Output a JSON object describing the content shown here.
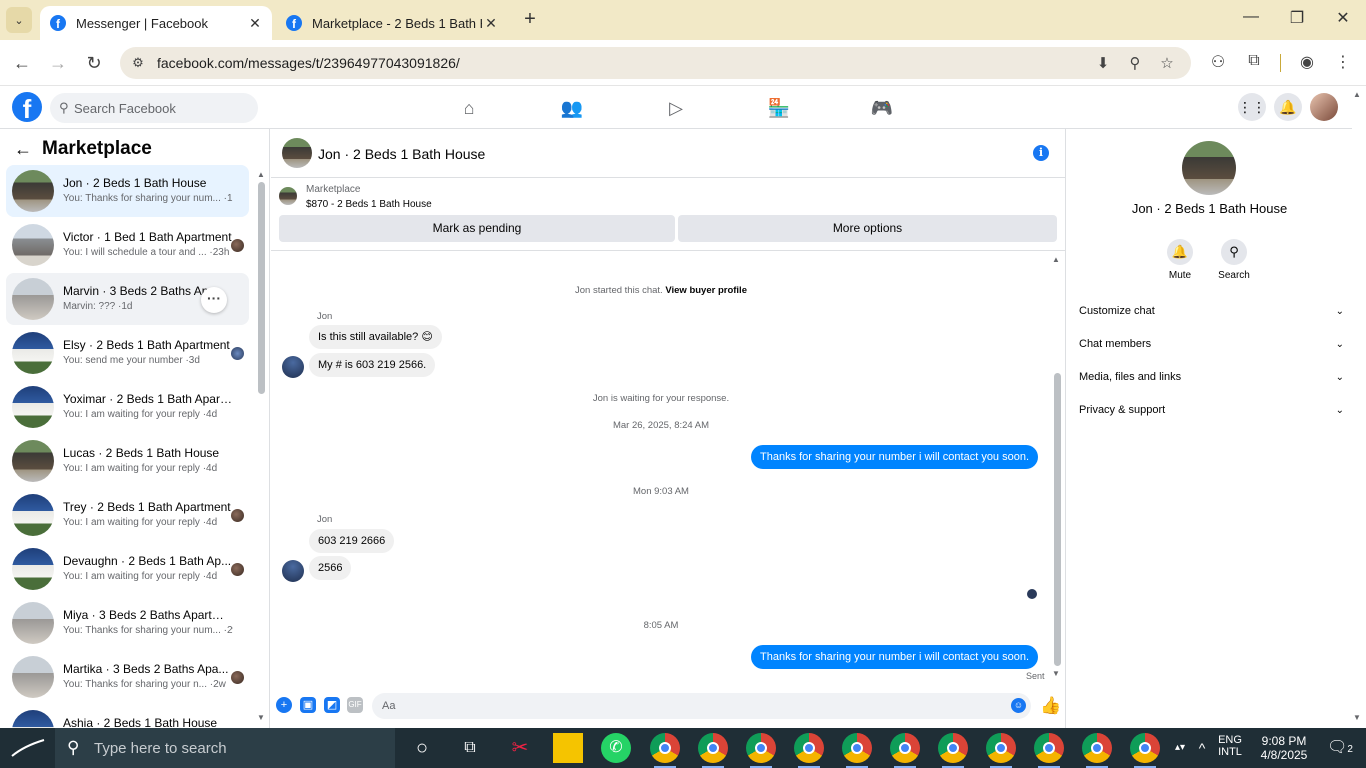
{
  "browser": {
    "tabs": [
      {
        "title": "Messenger | Facebook",
        "close": "✕"
      },
      {
        "title": "Marketplace - 2 Beds 1 Bath Ho",
        "close": "✕"
      }
    ],
    "new_tab": "+",
    "url": "facebook.com/messages/t/23964977043091826/"
  },
  "facebook": {
    "logo": "f",
    "search_placeholder": "Search Facebook"
  },
  "sidebar": {
    "title": "Marketplace",
    "conversations": [
      {
        "name": "Jon · 2 Beds 1 Bath House",
        "snippet": "You: Thanks for sharing your num... ·1m"
      },
      {
        "name": "Victor · 1 Bed 1 Bath Apartment",
        "snippet": "You: I will schedule a tour and ... ·23h"
      },
      {
        "name": "Marvin · 3 Beds 2 Baths Apa...",
        "snippet": "Marvin: ??? ·1d"
      },
      {
        "name": "Elsy · 2 Beds 1 Bath Apartment",
        "snippet": "You: send me your number ·3d"
      },
      {
        "name": "Yoximar · 2 Beds 1 Bath Apartm...",
        "snippet": "You: I am waiting for your reply ·4d"
      },
      {
        "name": "Lucas · 2 Beds 1 Bath House",
        "snippet": "You: I am waiting for your reply ·4d"
      },
      {
        "name": "Trey · 2 Beds 1 Bath Apartment",
        "snippet": "You: I am waiting for your reply ·4d"
      },
      {
        "name": "Devaughn · 2 Beds 1 Bath Ap...",
        "snippet": "You: I am waiting for your reply ·4d"
      },
      {
        "name": "Miya · 3 Beds 2 Baths Apartme...",
        "snippet": "You: Thanks for sharing your num... ·2w"
      },
      {
        "name": "Martika · 3 Beds 2 Baths Apa...",
        "snippet": "You: Thanks for sharing your n... ·2w"
      },
      {
        "name": "Ashia · 2 Beds 1 Bath House",
        "snippet": ""
      }
    ]
  },
  "chat": {
    "title": "Jon · 2 Beds 1 Bath House",
    "listing_source": "Marketplace",
    "listing_price": "$870 - 2 Beds 1 Bath House",
    "mark_pending": "Mark as pending",
    "more_options": "More options",
    "started_prefix": "Jon started this chat.",
    "view_profile": "View buyer profile",
    "sender_name": "Jon",
    "msg1": "Is this still available? 😊",
    "msg2": "My # is 603 219 2566.",
    "waiting": "Jon is waiting for your response.",
    "ts1": "Mar 26, 2025, 8:24 AM",
    "out1": "Thanks for sharing your number i will contact you soon.",
    "ts2": "Mon 9:03 AM",
    "msg3": "603 219 2666",
    "msg4": "2566",
    "ts3": "8:05 AM",
    "out2": "Thanks for sharing your number i will contact you soon.",
    "sent": "Sent",
    "composer_placeholder": "Aa",
    "gif": "GIF"
  },
  "right_panel": {
    "name": "Jon · 2 Beds 1 Bath House",
    "mute": "Mute",
    "search": "Search",
    "rows": [
      "Customize chat",
      "Chat members",
      "Media, files and links",
      "Privacy & support"
    ]
  },
  "taskbar": {
    "search_placeholder": "Type here to search",
    "lang1": "ENG",
    "lang2": "INTL",
    "time": "9:08 PM",
    "date": "4/8/2025",
    "notif_count": "2"
  }
}
